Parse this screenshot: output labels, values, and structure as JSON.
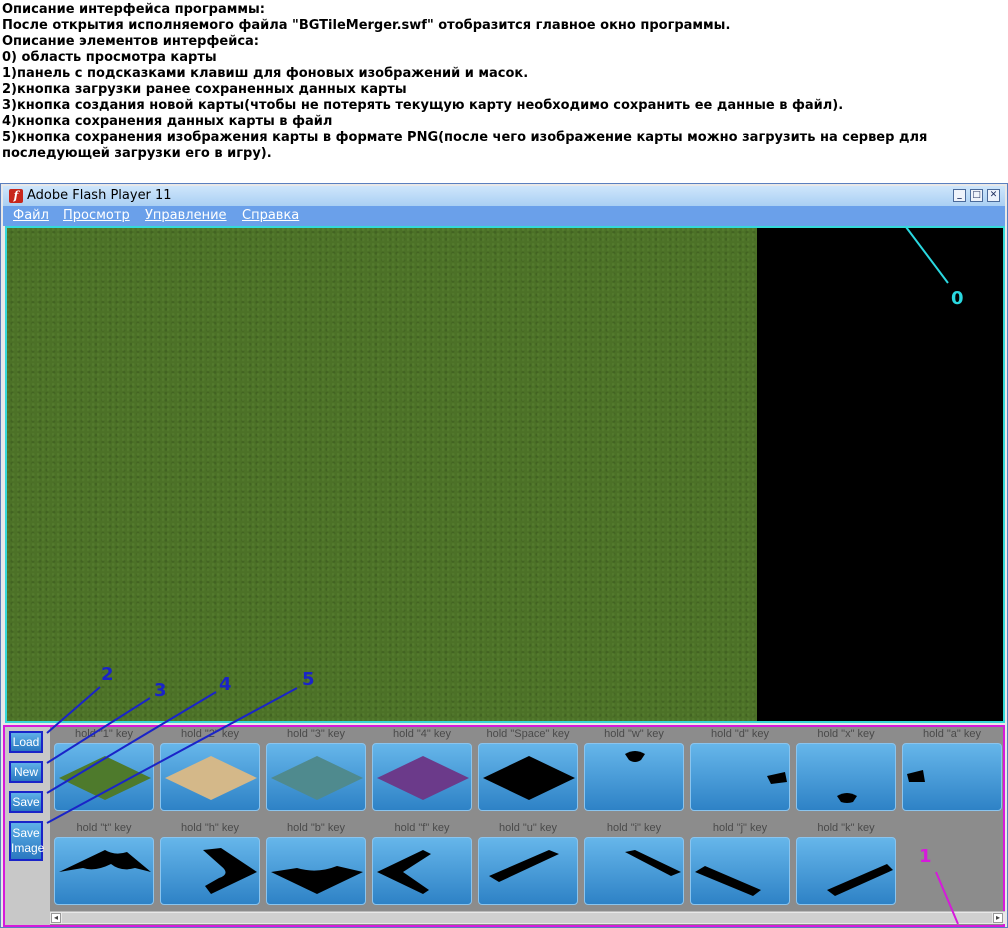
{
  "description": {
    "lines": [
      "Описание интерфейса программы:",
      "После открытия исполняемого файла \"BGTileMerger.swf\" отобразится главное окно программы.",
      "Описание элементов интерфейса:",
      "0) область просмотра карты",
      "1)панель с подсказками клавиш для фоновых изображений и масок.",
      "2)кнопка загрузки ранее сохраненных данных карты",
      "3)кнопка создания новой карты(чтобы не потерять текущую карту необходимо сохранить ее данные в файл).",
      "4)кнопка сохранения данных карты в файл",
      "5)кнопка сохранения изображения карты в формате PNG(после чего изображение карты можно загрузить на сервер для последующей загрузки его в игру)."
    ]
  },
  "window": {
    "title": "Adobe Flash Player 11",
    "menu": [
      "Файл",
      "Просмотр",
      "Управление",
      "Справка"
    ]
  },
  "buttons": {
    "load": "Load",
    "new": "New",
    "save": "Save",
    "save_image": "Save Image"
  },
  "tiles": {
    "row1": [
      {
        "label": "hold \"1\" key",
        "kind": "diamond",
        "color": "#4e7a2c"
      },
      {
        "label": "hold \"2\" key",
        "kind": "diamond",
        "color": "#d4b889"
      },
      {
        "label": "hold \"3\" key",
        "kind": "diamond",
        "color": "#4f8a8e"
      },
      {
        "label": "hold \"4\" key",
        "kind": "diamond",
        "color": "#6b3a8a"
      },
      {
        "label": "hold \"Space\" key",
        "kind": "diamond",
        "color": "#000000"
      },
      {
        "label": "hold \"w\" key",
        "kind": "blob-top",
        "color": "#000000"
      },
      {
        "label": "hold \"d\" key",
        "kind": "blob-right",
        "color": "#000000"
      },
      {
        "label": "hold \"x\" key",
        "kind": "blob-bottom",
        "color": "#000000"
      },
      {
        "label": "hold \"a\" key",
        "kind": "blob-left",
        "color": "#000000"
      }
    ],
    "row2": [
      {
        "label": "hold \"t\" key",
        "kind": "mask-t",
        "color": "#000000"
      },
      {
        "label": "hold \"h\" key",
        "kind": "mask-h",
        "color": "#000000"
      },
      {
        "label": "hold \"b\" key",
        "kind": "mask-b",
        "color": "#000000"
      },
      {
        "label": "hold \"f\" key",
        "kind": "mask-f",
        "color": "#000000"
      },
      {
        "label": "hold \"u\" key",
        "kind": "mask-u",
        "color": "#000000"
      },
      {
        "label": "hold \"i\" key",
        "kind": "mask-i",
        "color": "#000000"
      },
      {
        "label": "hold \"j\" key",
        "kind": "mask-j",
        "color": "#000000"
      },
      {
        "label": "hold \"k\" key",
        "kind": "mask-k",
        "color": "#000000"
      }
    ]
  },
  "annotations": [
    {
      "label": "0",
      "color": "#2ad8e0"
    },
    {
      "label": "1",
      "color": "#d61adb"
    },
    {
      "label": "2",
      "color": "#1a24c8"
    },
    {
      "label": "3",
      "color": "#1a24c8"
    },
    {
      "label": "4",
      "color": "#1a24c8"
    },
    {
      "label": "5",
      "color": "#1a24c8"
    }
  ],
  "icons": {
    "app": "flash-icon",
    "minimize": "minimize-icon",
    "maximize": "maximize-icon",
    "close": "close-icon"
  },
  "colors": {
    "grass": "#4c7127",
    "viewport_border": "#35d8d8",
    "panel_border": "#d61adb",
    "menubar": "#6aa0ea"
  }
}
